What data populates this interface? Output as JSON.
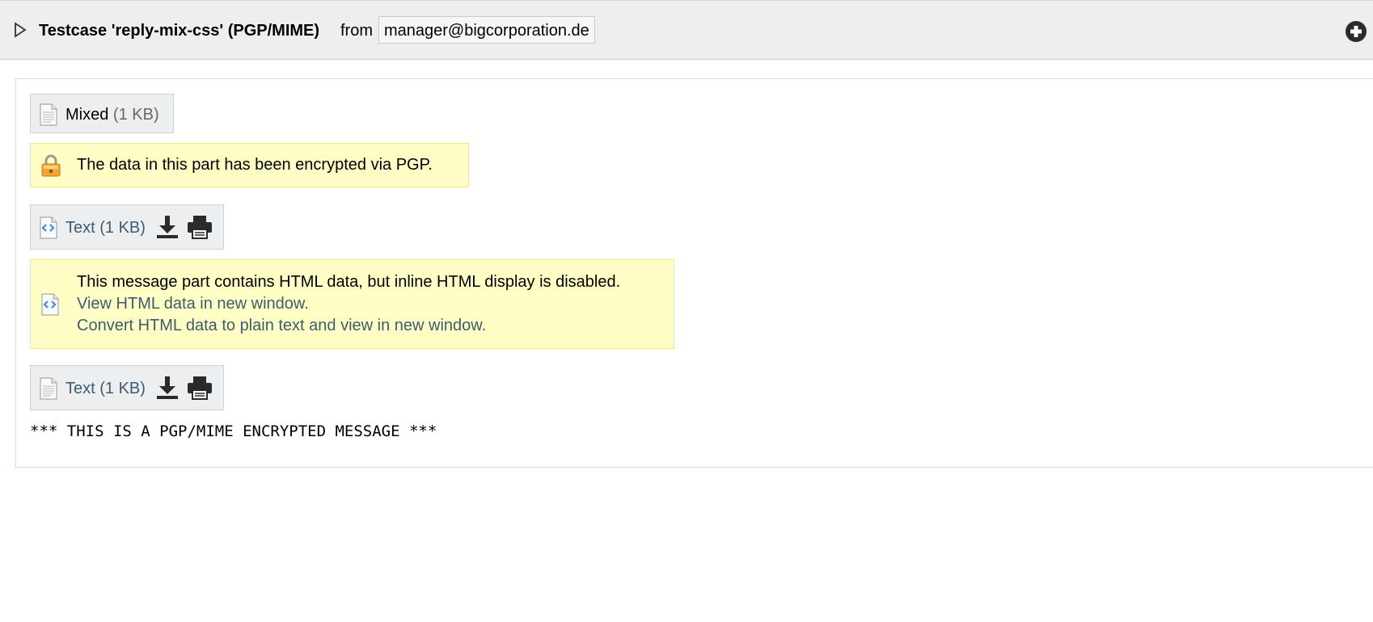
{
  "header": {
    "subject": "Testcase 'reply-mix-css' (PGP/MIME)",
    "from_label": "from",
    "from_address": "manager@bigcorporation.de"
  },
  "parts": {
    "mixed": {
      "name": "Mixed",
      "size": "(1 KB)"
    },
    "pgp_notice": "The data in this part has been encrypted via PGP.",
    "html_part": {
      "name": "Text",
      "size": "(1 KB)"
    },
    "html_notice": {
      "message": "This message part contains HTML data, but inline HTML display is disabled.",
      "view_link": "View HTML data in new window.",
      "convert_link": "Convert HTML data to plain text and view in new window."
    },
    "text_part": {
      "name": "Text",
      "size": "(1 KB)"
    },
    "body_text": "*** THIS IS A PGP/MIME ENCRYPTED MESSAGE ***"
  },
  "icons": {
    "toggle": "triangle-right-icon",
    "add": "plus-circle-icon",
    "file": "document-icon",
    "html_file": "html-document-icon",
    "lock": "lock-icon",
    "download": "download-icon",
    "print": "printer-icon"
  },
  "colors": {
    "header_bg": "#eceeef",
    "notice_bg": "#ffffc5",
    "link": "#3d5b70",
    "frame_border": "#c6ebc6"
  }
}
